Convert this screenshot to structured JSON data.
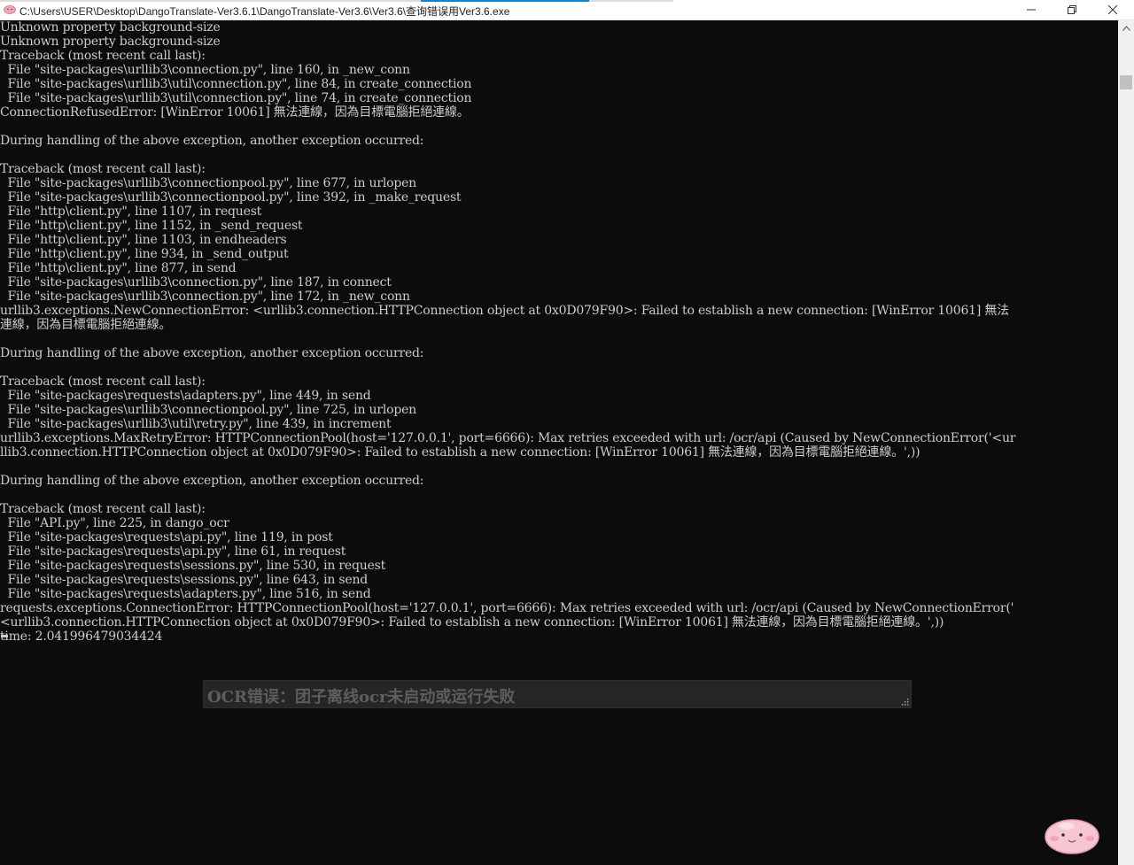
{
  "window": {
    "title": "C:\\Users\\USER\\Desktop\\DangoTranslate-Ver3.6.1\\DangoTranslate-Ver3.6\\Ver3.6\\查询错误用Ver3.6.exe",
    "buttons": {
      "minimize": "–",
      "maximize": "❐",
      "close": "✕"
    }
  },
  "console": {
    "lines": [
      "Unknown property background-size",
      "Unknown property background-size",
      "Traceback (most recent call last):",
      "  File \"site-packages\\urllib3\\connection.py\", line 160, in _new_conn",
      "  File \"site-packages\\urllib3\\util\\connection.py\", line 84, in create_connection",
      "  File \"site-packages\\urllib3\\util\\connection.py\", line 74, in create_connection",
      "ConnectionRefusedError: [WinError 10061] 無法連線，因為目標電腦拒絕連線。",
      "",
      "During handling of the above exception, another exception occurred:",
      "",
      "Traceback (most recent call last):",
      "  File \"site-packages\\urllib3\\connectionpool.py\", line 677, in urlopen",
      "  File \"site-packages\\urllib3\\connectionpool.py\", line 392, in _make_request",
      "  File \"http\\client.py\", line 1107, in request",
      "  File \"http\\client.py\", line 1152, in _send_request",
      "  File \"http\\client.py\", line 1103, in endheaders",
      "  File \"http\\client.py\", line 934, in _send_output",
      "  File \"http\\client.py\", line 877, in send",
      "  File \"site-packages\\urllib3\\connection.py\", line 187, in connect",
      "  File \"site-packages\\urllib3\\connection.py\", line 172, in _new_conn",
      "urllib3.exceptions.NewConnectionError: <urllib3.connection.HTTPConnection object at 0x0D079F90>: Failed to establish a new connection: [WinError 10061] 無法",
      "連線，因為目標電腦拒絕連線。",
      "",
      "During handling of the above exception, another exception occurred:",
      "",
      "Traceback (most recent call last):",
      "  File \"site-packages\\requests\\adapters.py\", line 449, in send",
      "  File \"site-packages\\urllib3\\connectionpool.py\", line 725, in urlopen",
      "  File \"site-packages\\urllib3\\util\\retry.py\", line 439, in increment",
      "urllib3.exceptions.MaxRetryError: HTTPConnectionPool(host='127.0.0.1', port=6666): Max retries exceeded with url: /ocr/api (Caused by NewConnectionError('<ur",
      "llib3.connection.HTTPConnection object at 0x0D079F90>: Failed to establish a new connection: [WinError 10061] 無法連線，因為目標電腦拒絕連線。',))",
      "",
      "During handling of the above exception, another exception occurred:",
      "",
      "Traceback (most recent call last):",
      "  File \"API.py\", line 225, in dango_ocr",
      "  File \"site-packages\\requests\\api.py\", line 119, in post",
      "  File \"site-packages\\requests\\api.py\", line 61, in request",
      "  File \"site-packages\\requests\\sessions.py\", line 530, in request",
      "  File \"site-packages\\requests\\sessions.py\", line 643, in send",
      "  File \"site-packages\\requests\\adapters.py\", line 516, in send",
      "requests.exceptions.ConnectionError: HTTPConnectionPool(host='127.0.0.1', port=6666): Max retries exceeded with url: /ocr/api (Caused by NewConnectionError('",
      "<urllib3.connection.HTTPConnection object at 0x0D079F90>: Failed to establish a new connection: [WinError 10061] 無法連線，因為目標電腦拒絕連線。',))",
      "time: 2.041996479034424"
    ]
  },
  "ocr_overlay": {
    "message": "OCR错误：团子离线ocr未启动或运行失败"
  },
  "icons": {
    "app": "dango-app-icon",
    "mascot": "dango-mascot-icon",
    "resize": "resize-grip-icon"
  }
}
